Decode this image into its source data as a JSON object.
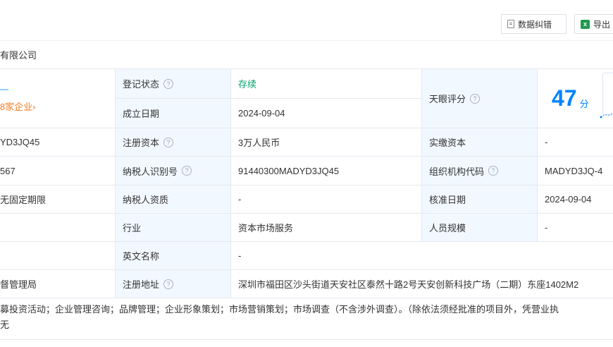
{
  "toolbar": {
    "correct_label": "数据纠错",
    "export_label": "导出"
  },
  "company_name_fragment": "有限公司",
  "left_fragments": {
    "row1_mark": "—",
    "row1_link": "8家企业›",
    "credit_code_frag": "YD3JQ45",
    "reg_no_frag": "567",
    "term_frag": "无固定期限",
    "authority_frag": "督管理局"
  },
  "fields": {
    "status": {
      "label": "登记状态",
      "value": "存续"
    },
    "established": {
      "label": "成立日期",
      "value": "2024-09-04"
    },
    "score": {
      "label": "天眼评分",
      "value": "47",
      "unit": "分"
    },
    "reg_capital": {
      "label": "注册资本",
      "value": "3万人民币"
    },
    "paid_capital": {
      "label": "实缴资本",
      "value": "-"
    },
    "taxpayer_id": {
      "label": "纳税人识别号",
      "value": "91440300MADYD3JQ45"
    },
    "org_code": {
      "label": "组织机构代码",
      "value": "MADYD3JQ-4"
    },
    "taxpayer_qual": {
      "label": "纳税人资质",
      "value": "-"
    },
    "approval_date": {
      "label": "核准日期",
      "value": "2024-09-04"
    },
    "industry": {
      "label": "行业",
      "value": "资本市场服务"
    },
    "staff_size": {
      "label": "人员规模",
      "value": "-"
    },
    "english_name": {
      "label": "英文名称",
      "value": "-"
    },
    "address": {
      "label": "注册地址",
      "value": "深圳市福田区沙头街道天安社区泰然十路2号天安创新科技广场（二期）东座1402M2"
    }
  },
  "scope": {
    "line1": "募投资活动；企业管理咨询；品牌管理；企业形象策划；市场营销策划；市场调查（不含涉外调查）。（除依法须经批准的项目外，凭营业执",
    "line2": "无"
  },
  "colors": {
    "label_bg": "#f2f8ff",
    "border": "#e4e8ef",
    "status_green": "#00a36c",
    "score_blue": "#0084ff",
    "link_orange": "#f47b20"
  }
}
